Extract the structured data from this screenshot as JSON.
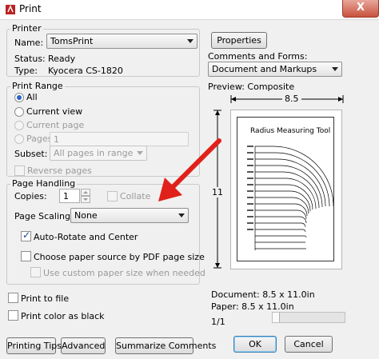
{
  "window": {
    "title": "Print",
    "close_label": "X"
  },
  "printer": {
    "group_label": "Printer",
    "name_label": "Name:",
    "name_value": "TomsPrint",
    "properties_label": "Properties",
    "status_label": "Status:",
    "status_value": "Ready",
    "type_label": "Type:",
    "type_value": "Kyocera CS-1820",
    "comments_label": "Comments and Forms:",
    "comments_value": "Document and Markups"
  },
  "print_range": {
    "group_label": "Print Range",
    "all_label": "All",
    "current_view_label": "Current view",
    "current_page_label": "Current page",
    "pages_label": "Pages",
    "pages_value": "1",
    "subset_label": "Subset:",
    "subset_value": "All pages in range",
    "reverse_label": "Reverse pages"
  },
  "page_handling": {
    "group_label": "Page Handling",
    "copies_label": "Copies:",
    "copies_value": "1",
    "collate_label": "Collate",
    "scaling_label": "Page Scaling:",
    "scaling_value": "None",
    "auto_rotate_label": "Auto-Rotate and Center",
    "choose_source_label": "Choose paper source by PDF page size",
    "custom_paper_label": "Use custom paper size when needed"
  },
  "options": {
    "print_to_file_label": "Print to file",
    "print_color_black_label": "Print color as black"
  },
  "preview": {
    "label": "Preview: Composite",
    "width_dim": "8.5",
    "height_dim": "11",
    "page_title": "Radius Measuring Tool",
    "document_info": "Document: 8.5 x 11.0in",
    "paper_info": "Paper: 8.5 x 11.0in",
    "page_counter": "1/1"
  },
  "buttons": {
    "printing_tips": "Printing Tips",
    "advanced": "Advanced",
    "summarize": "Summarize Comments",
    "ok": "OK",
    "cancel": "Cancel"
  },
  "annotation_arrow": {
    "color": "#e0211b"
  }
}
